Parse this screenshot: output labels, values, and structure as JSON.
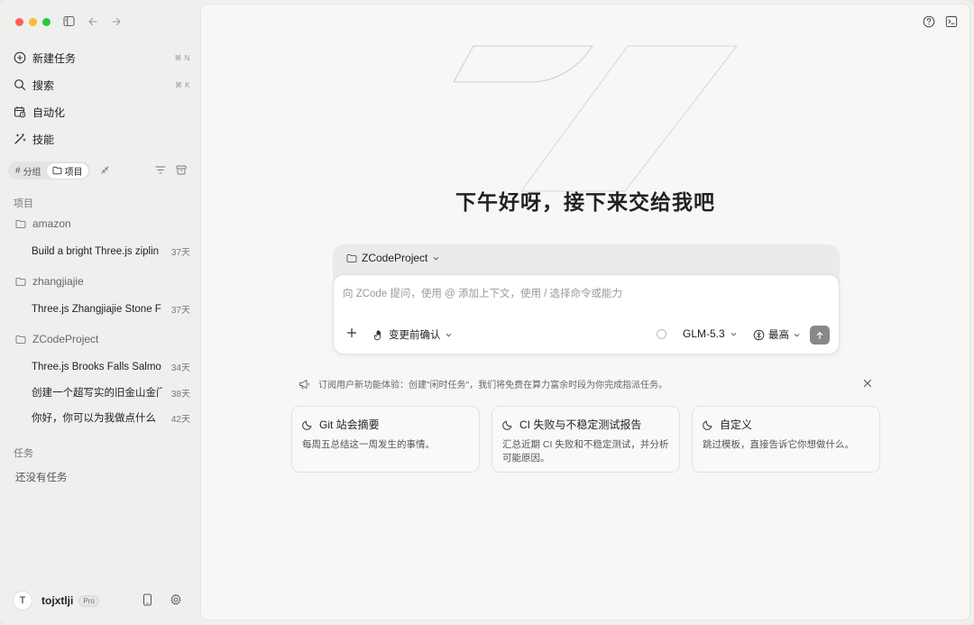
{
  "sidebar": {
    "nav": [
      {
        "label": "新建任务",
        "shortcut": "⌘ N"
      },
      {
        "label": "搜索",
        "shortcut": "⌘ K"
      },
      {
        "label": "自动化"
      },
      {
        "label": "技能"
      }
    ],
    "view_toggle": {
      "group_label": "分组",
      "project_label": "项目"
    },
    "projects_header": "项目",
    "projects": [
      {
        "name": "amazon",
        "tasks": [
          {
            "title": "Build a bright Three.js ziplin",
            "age": "37天"
          }
        ]
      },
      {
        "name": "zhangjiajie",
        "tasks": [
          {
            "title": "Three.js Zhangjiajie Stone F",
            "age": "37天"
          }
        ]
      },
      {
        "name": "ZCodeProject",
        "tasks": [
          {
            "title": "Three.js Brooks Falls Salmo",
            "age": "34天"
          },
          {
            "title": "创建一个超写实的旧金山金门",
            "age": "38天"
          },
          {
            "title": "你好，你可以为我做点什么",
            "age": "42天"
          }
        ]
      }
    ],
    "tasks_header": "任务",
    "tasks_empty": "还没有任务",
    "user": {
      "initial": "T",
      "name": "tojxtlji",
      "plan": "Pro"
    }
  },
  "main": {
    "greeting": "下午好呀，接下来交给我吧",
    "composer": {
      "project": "ZCodeProject",
      "placeholder": "向 ZCode 提问，使用 @ 添加上下文，使用 / 选择命令或能力",
      "confirm_mode": "变更前确认",
      "model": "GLM-5.3",
      "level": "最高"
    },
    "notice": "订阅用户新功能体验：创建\"闲时任务\"，我们将免费在算力富余时段为你完成指派任务。",
    "cards": [
      {
        "title": "Git 站会摘要",
        "desc": "每周五总结这一周发生的事情。"
      },
      {
        "title": "CI 失败与不稳定测试报告",
        "desc": "汇总近期 CI 失败和不稳定测试，并分析可能原因。"
      },
      {
        "title": "自定义",
        "desc": "跳过模板，直接告诉它你想做什么。"
      }
    ]
  },
  "colors": {
    "send_button": "#888888",
    "sidebar_bg": "#efefed",
    "main_bg": "#f7f7f6"
  }
}
